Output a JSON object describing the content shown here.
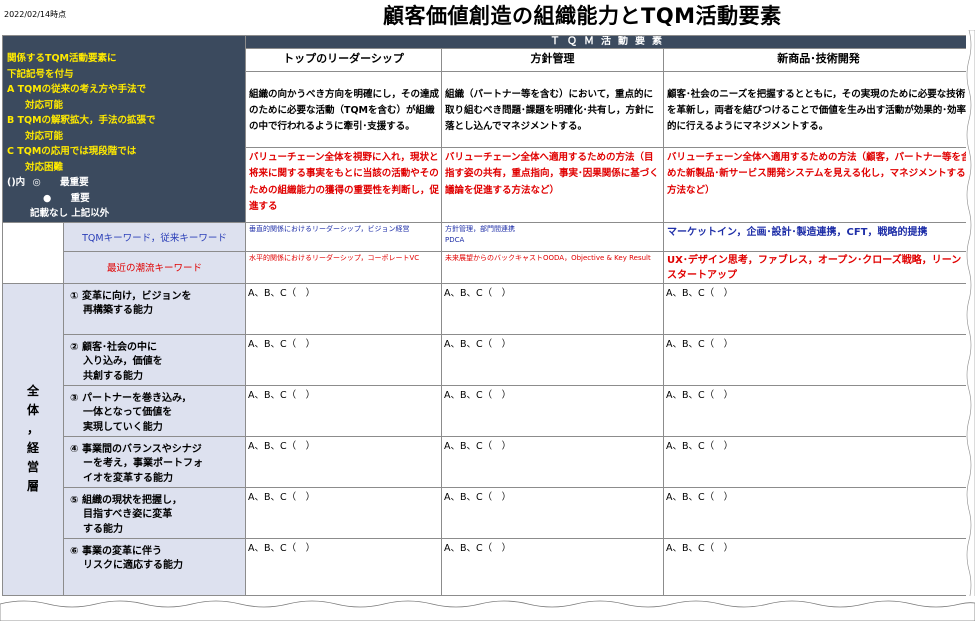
{
  "date": "2022/02/14時点",
  "title": "顧客価値創造の組織能力とTQM活動要素",
  "legend": {
    "line1": "関係するTQM活動要素に",
    "line2": "下記記号を付与",
    "a1": "A TQMの従来の考え方や手法で",
    "a2": "対応可能",
    "b1": "B TQMの解釈拡大，手法の拡張で",
    "b2": "対応可能",
    "c1": "C TQMの応用では現段階では",
    "c2": "対応困難",
    "mark_prefix": "()内",
    "sym1": "◎",
    "sym1_label": "最重要",
    "sym2": "●",
    "sym2_label": "重要",
    "other": "記載なし 上記以外"
  },
  "tqm_header": "ＴＱＭ活動要素",
  "columns": [
    {
      "head": "トップのリーダーシップ",
      "desc": "組織の向かうべき方向を明確にし，その達成のために必要な活動（TQMを含む）が組織の中で行われるように牽引･支援する。",
      "method": "バリューチェーン全体を視野に入れ，現状と将来に関する事実をもとに当該の活動やそのための組織能力の獲得の重要性を判断し，促進する",
      "kw_tqm": "垂直的関係におけるリーダーシップ，ビジョン経営",
      "kw_trend": "水平的関係におけるリーダーシップ，コーポレートVC"
    },
    {
      "head": "方針管理",
      "desc": "組織（パートナー等を含む）において，重点的に取り組むべき問題･課題を明確化･共有し，方針に落とし込んでマネジメントする。",
      "method": "バリューチェーン全体へ適用するための方法（目指す姿の共有，重点指向，事実･因果関係に基づく議論を促進する方法など）",
      "kw_tqm": "方針管理，部門間連携\nPDCA",
      "kw_trend": "未来展望からのバックキャストOODA，Objective & Key Result"
    },
    {
      "head": "新商品･技術開発",
      "desc": "顧客･社会のニーズを把握するとともに，その実現のために必要な技術を革新し，両者を結びつけることで価値を生み出す活動が効果的･効率的に行えるようにマネジメントする。",
      "method": "バリューチェーン全体へ適用するための方法（顧客，パートナー等を含めた新製品･新サービス開発システムを見える化し，マネジメントする方法など）",
      "kw_tqm": "マーケットイン，企画･設計･製造連携，CFT，戦略的提携",
      "kw_trend": "UX･デザイン思考，ファブレス，オープン･クローズ戦略，リーンスタートアップ"
    }
  ],
  "kw_labels": {
    "tqm": "TQMキーワード，従来キーワード",
    "trend": "最近の潮流キーワード"
  },
  "section_label": [
    "全",
    "体",
    "，",
    "経",
    "営",
    "層"
  ],
  "abilities": [
    {
      "l1": "① 変革に向け，ビジョンを",
      "l2": "再構築する能力",
      "l3": ""
    },
    {
      "l1": "② 顧客･社会の中に",
      "l2": "入り込み，価値を",
      "l3": "共創する能力"
    },
    {
      "l1": "③ パートナーを巻き込み，",
      "l2": "一体となって価値を",
      "l3": "実現していく能力"
    },
    {
      "l1": "④ 事業間のバランスやシナジ",
      "l2": "ーを考え，事業ポートフォ",
      "l3": "イオを変革する能力"
    },
    {
      "l1": "⑤ 組織の現状を把握し，",
      "l2": "目指すべき姿に変革",
      "l3": "する能力"
    },
    {
      "l1": "⑥ 事業の変革に伴う",
      "l2": "リスクに適応する能力",
      "l3": ""
    }
  ],
  "check_text": "A、B、C（　）"
}
